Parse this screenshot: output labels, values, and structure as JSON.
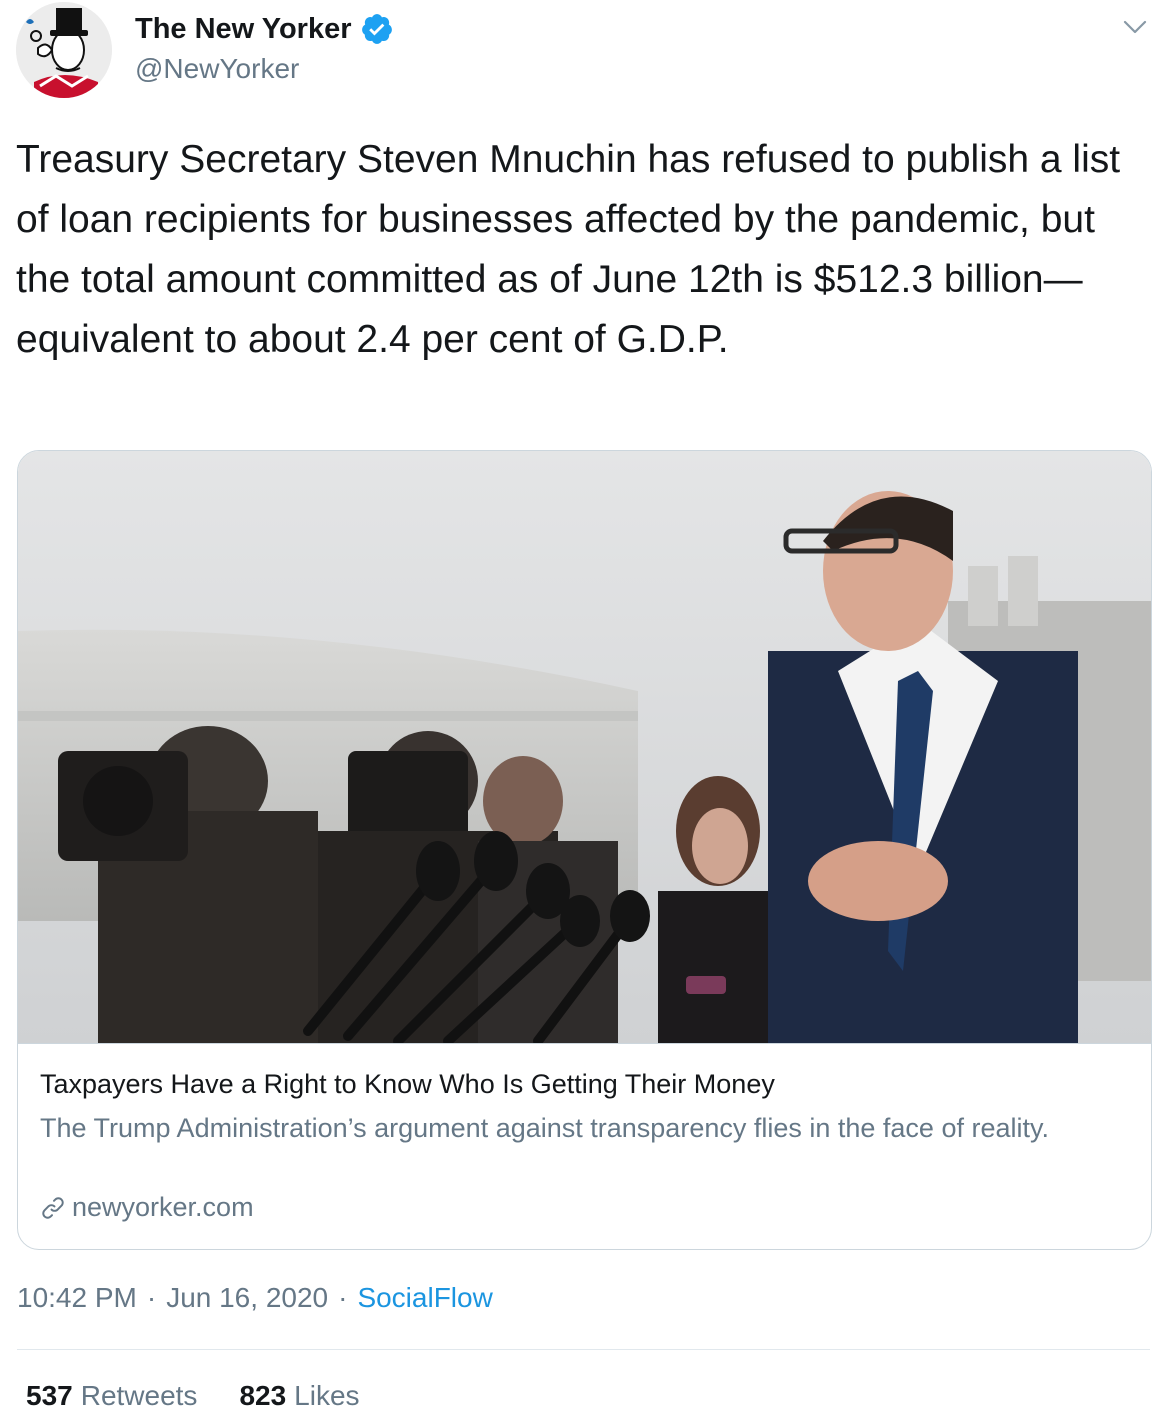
{
  "colors": {
    "text_primary": "#14171a",
    "text_secondary": "#657786",
    "accent": "#1b95e0",
    "verified": "#1da1f2",
    "border": "#ccd6dd"
  },
  "header": {
    "display_name": "The New Yorker",
    "handle": "@NewYorker",
    "verified_icon": "verified-badge-icon",
    "menu_icon": "chevron-down-icon"
  },
  "tweet": {
    "text": "Treasury Secretary Steven Mnuchin has refused to publish a list of loan recipients for businesses affected by the pandemic, but the total amount committed as of June 12th is $512.3 billion—equivalent to about 2.4 per cent of G.D.P."
  },
  "card": {
    "title": "Taxpayers Have a Right to Know Who Is Getting Their Money",
    "description": "The Trump Administration’s argument against transparency flies in the face of reality.",
    "domain": "newyorker.com",
    "link_icon": "link-icon"
  },
  "meta": {
    "time": "10:42 PM",
    "separator": "·",
    "date": "Jun 16, 2020",
    "source": "SocialFlow"
  },
  "stats": {
    "retweets_count": "537",
    "retweets_label": "Retweets",
    "likes_count": "823",
    "likes_label": "Likes"
  }
}
